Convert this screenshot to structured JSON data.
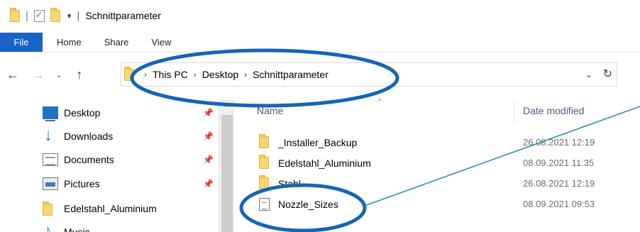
{
  "window": {
    "title": "Schnittparameter"
  },
  "ribbon": {
    "tabs": [
      "File",
      "Home",
      "Share",
      "View"
    ]
  },
  "address": {
    "crumbs": [
      "This PC",
      "Desktop",
      "Schnittparameter"
    ]
  },
  "nav_pane": {
    "items": [
      {
        "label": "Desktop",
        "icon": "desktop-icon",
        "pinned": true
      },
      {
        "label": "Downloads",
        "icon": "downloads-icon",
        "pinned": true
      },
      {
        "label": "Documents",
        "icon": "documents-icon",
        "pinned": true
      },
      {
        "label": "Pictures",
        "icon": "pictures-icon",
        "pinned": true
      },
      {
        "label": "Edelstahl_Aluminium",
        "icon": "folder-icon",
        "pinned": false
      },
      {
        "label": "Music",
        "icon": "music-icon",
        "pinned": false
      }
    ]
  },
  "file_list": {
    "columns": {
      "name": "Name",
      "date": "Date modified"
    },
    "rows": [
      {
        "name": "_Installer_Backup",
        "date": "26.08.2021 12:19",
        "icon": "folder-icon"
      },
      {
        "name": "Edelstahl_Aluminium",
        "date": "08.09.2021 11:35",
        "icon": "folder-icon"
      },
      {
        "name": "Stahl",
        "date": "26.08.2021 12:19",
        "icon": "folder-icon"
      },
      {
        "name": "Nozzle_Sizes",
        "date": "08.09.2021 09:53",
        "icon": "text-file-icon"
      }
    ]
  },
  "colors": {
    "file_tab": "#1a63c6",
    "annotation": "#1565b8",
    "folder": "#f8d775"
  }
}
